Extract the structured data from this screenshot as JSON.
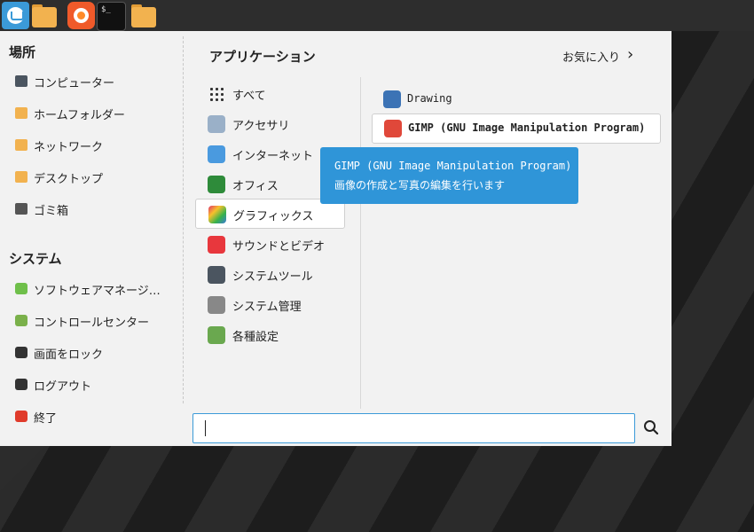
{
  "panel": {
    "launchers": [
      {
        "name": "menu"
      },
      {
        "name": "files"
      },
      {
        "name": "firefox"
      },
      {
        "name": "terminal",
        "glyph": "$_"
      },
      {
        "name": "folder"
      }
    ]
  },
  "places": {
    "title": "場所",
    "items": [
      {
        "label": "コンピューター",
        "icon": "computer-icon"
      },
      {
        "label": "ホームフォルダー",
        "icon": "home-folder-icon"
      },
      {
        "label": "ネットワーク",
        "icon": "network-folder-icon"
      },
      {
        "label": "デスクトップ",
        "icon": "desktop-folder-icon"
      },
      {
        "label": "ゴミ箱",
        "icon": "trash-icon"
      }
    ]
  },
  "system": {
    "title": "システム",
    "items": [
      {
        "label": "ソフトウェアマネージ…",
        "icon": "software-manager-icon"
      },
      {
        "label": "コントロールセンター",
        "icon": "control-center-icon"
      },
      {
        "label": "画面をロック",
        "icon": "lock-icon"
      },
      {
        "label": "ログアウト",
        "icon": "logout-icon"
      },
      {
        "label": "終了",
        "icon": "power-icon"
      }
    ]
  },
  "applications": {
    "title": "アプリケーション",
    "favorites_label": "お気に入り",
    "categories": [
      {
        "label": "すべて"
      },
      {
        "label": "アクセサリ"
      },
      {
        "label": "インターネット"
      },
      {
        "label": "オフィス"
      },
      {
        "label": "グラフィックス"
      },
      {
        "label": "サウンドとビデオ"
      },
      {
        "label": "システムツール"
      },
      {
        "label": "システム管理"
      },
      {
        "label": "各種設定"
      }
    ],
    "selected_category": "グラフィックス",
    "apps": [
      {
        "label": "Drawing",
        "icon": "drawing-icon"
      },
      {
        "label": "GIMP (GNU Image Manipulation Program)",
        "icon": "gimp-icon"
      }
    ]
  },
  "tooltip": {
    "title": "GIMP (GNU Image Manipulation Program)",
    "description": "画像の作成と写真の編集を行います"
  },
  "search": {
    "value": "",
    "placeholder": ""
  },
  "colors": {
    "accent": "#3b9ad8",
    "tooltip_bg": "#2f95d8"
  }
}
